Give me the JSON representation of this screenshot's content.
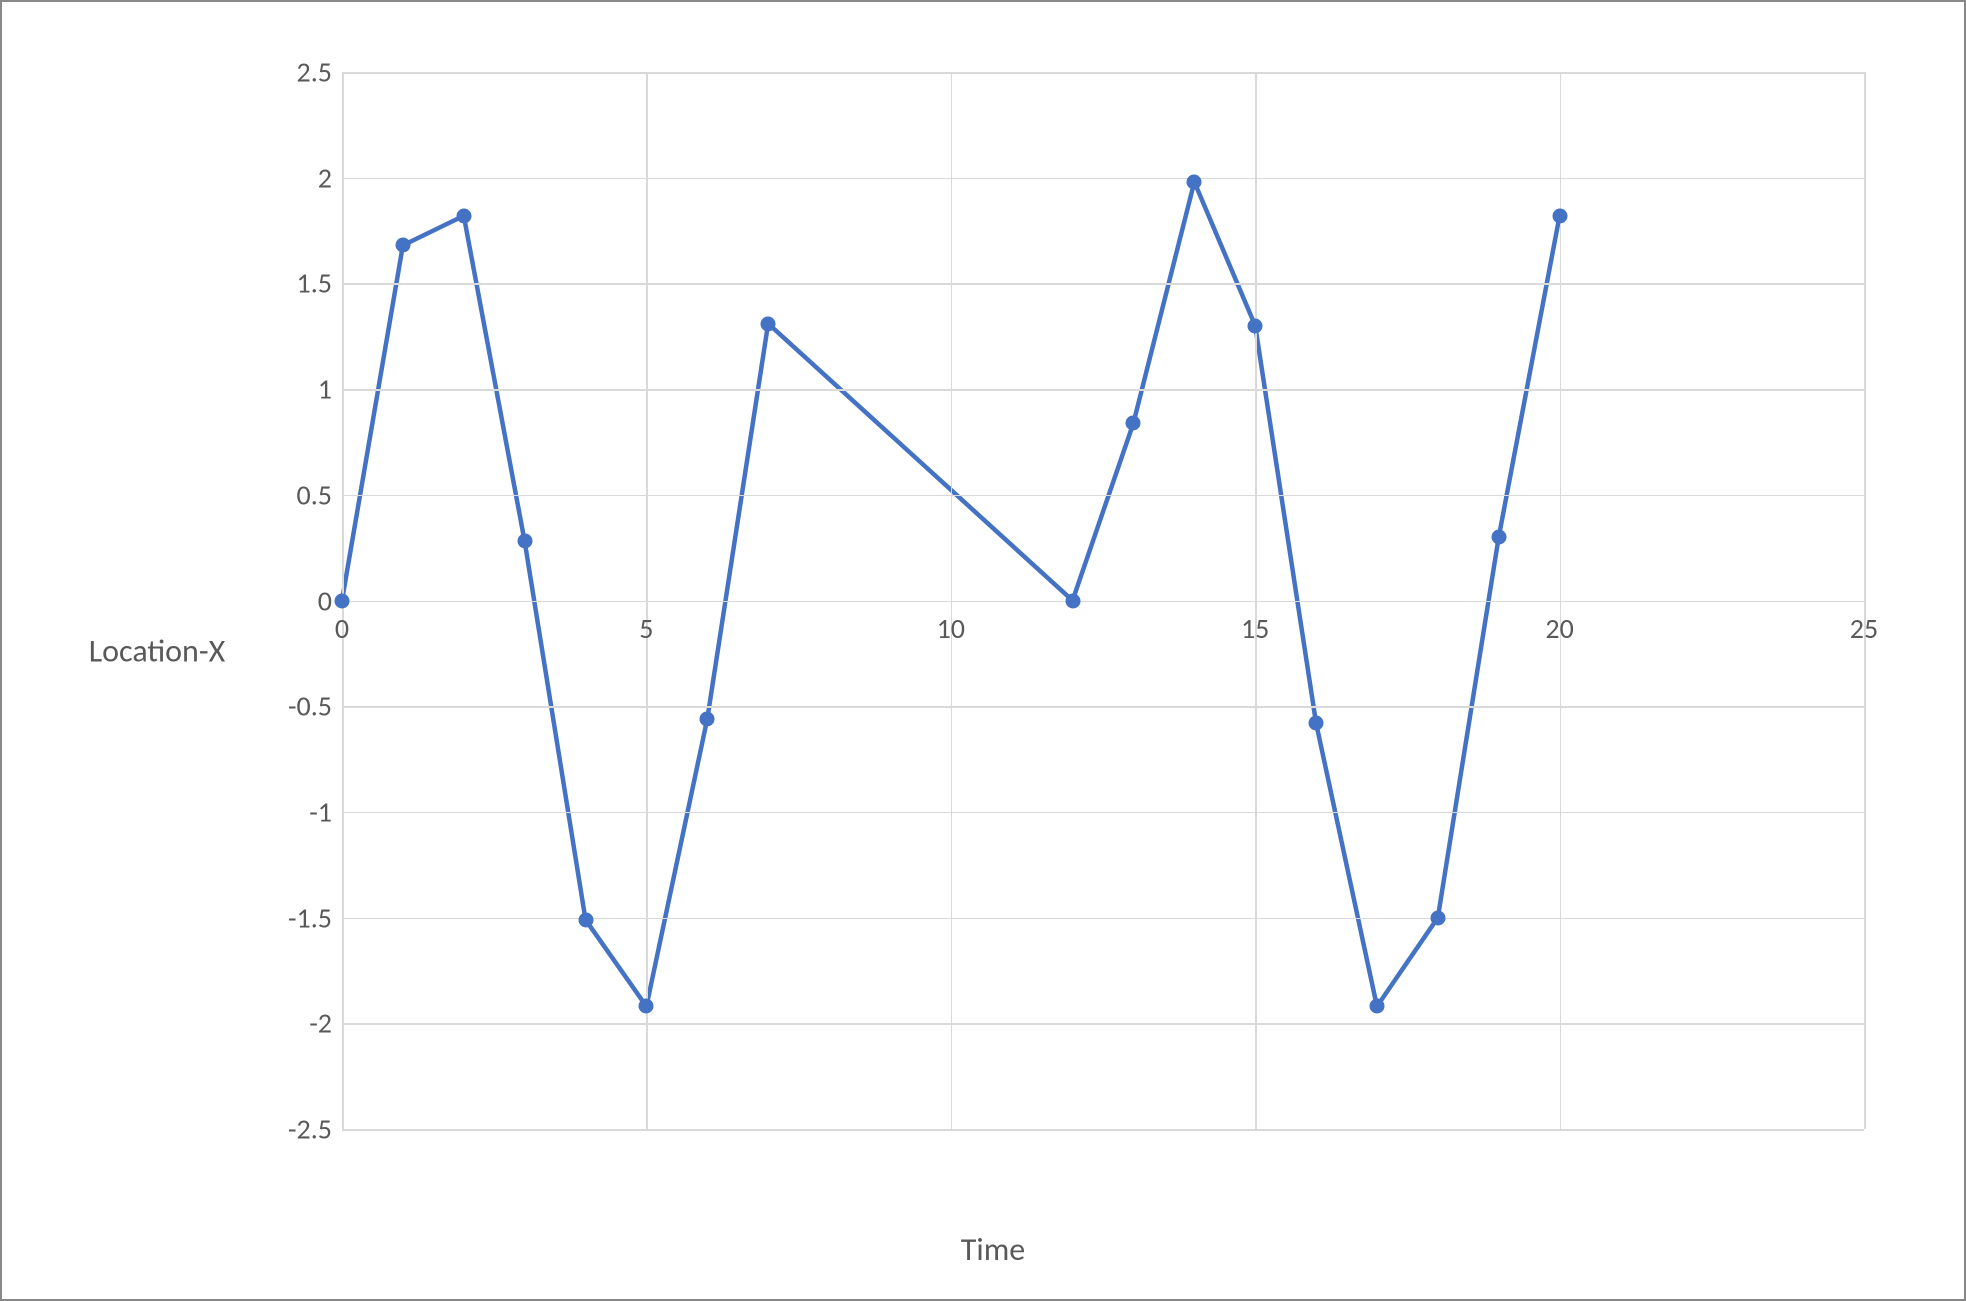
{
  "chart_data": {
    "type": "line",
    "title": "",
    "xlabel": "Time",
    "ylabel": "Location-X",
    "xlim": [
      0,
      25
    ],
    "ylim": [
      -2.5,
      2.5
    ],
    "x_ticks": [
      0,
      5,
      10,
      15,
      20,
      25
    ],
    "y_ticks": [
      -2.5,
      -2,
      -1.5,
      -1,
      -0.5,
      0,
      0.5,
      1,
      1.5,
      2,
      2.5
    ],
    "x": [
      0,
      1,
      2,
      3,
      4,
      5,
      6,
      7,
      12,
      13,
      14,
      15,
      16,
      17,
      18,
      19,
      20
    ],
    "values": [
      0,
      1.68,
      1.82,
      0.28,
      -1.51,
      -1.92,
      -0.56,
      1.31,
      0,
      0.84,
      1.98,
      1.3,
      -0.58,
      -1.92,
      -1.5,
      0.3,
      1.82
    ],
    "series_color": "#4472c4",
    "grid": true
  }
}
